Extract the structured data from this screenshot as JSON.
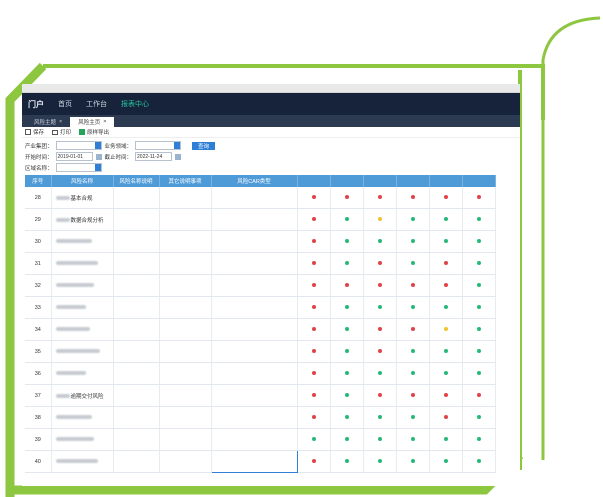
{
  "header": {
    "logo": "门户",
    "nav": [
      "首页",
      "工作台",
      "报表中心"
    ],
    "active_nav": 2
  },
  "tabs": [
    {
      "label": "风险主题"
    },
    {
      "label": "风险主页"
    }
  ],
  "toolbar": {
    "save": "保存",
    "print": "打印",
    "export": "原样导出"
  },
  "filters": {
    "industry_label": "产业集团：",
    "domain_label": "业务领域：",
    "start_label": "开始时间：",
    "start_value": "2019-01-01",
    "end_label": "截止时间：",
    "end_value": "2022-11-24",
    "region_label": "区域名称：",
    "query_btn": "查询"
  },
  "table": {
    "headers": [
      "序号",
      "风险名称",
      "风险名称说明",
      "其它说明事项",
      "风险CAR类型",
      "",
      "",
      "",
      "",
      "",
      ""
    ],
    "rows": [
      {
        "no": "28",
        "name": "基本合规"
      },
      {
        "no": "29",
        "name": "数据合规分析"
      },
      {
        "no": "30",
        "name": ""
      },
      {
        "no": "31",
        "name": ""
      },
      {
        "no": "32",
        "name": ""
      },
      {
        "no": "33",
        "name": ""
      },
      {
        "no": "34",
        "name": ""
      },
      {
        "no": "35",
        "name": ""
      },
      {
        "no": "36",
        "name": ""
      },
      {
        "no": "37",
        "name": "逾期交付风险"
      },
      {
        "no": "38",
        "name": ""
      },
      {
        "no": "39",
        "name": ""
      },
      {
        "no": "40",
        "name": ""
      }
    ],
    "status_colors": {
      "red": "#e0444a",
      "green": "#27b97a",
      "yellow": "#f2c230"
    },
    "status": [
      [
        "red",
        "red",
        "red",
        "red",
        "red",
        "red"
      ],
      [
        "red",
        "green",
        "yellow",
        "green",
        "green",
        "green"
      ],
      [
        "red",
        "green",
        "green",
        "green",
        "green",
        "green"
      ],
      [
        "red",
        "green",
        "red",
        "green",
        "red",
        "green"
      ],
      [
        "red",
        "red",
        "red",
        "red",
        "red",
        "green"
      ],
      [
        "red",
        "green",
        "green",
        "green",
        "green",
        "green"
      ],
      [
        "red",
        "green",
        "red",
        "red",
        "yellow",
        "green"
      ],
      [
        "red",
        "green",
        "red",
        "green",
        "green",
        "green"
      ],
      [
        "red",
        "green",
        "green",
        "green",
        "green",
        "green"
      ],
      [
        "red",
        "green",
        "red",
        "red",
        "red",
        "red"
      ],
      [
        "red",
        "green",
        "green",
        "green",
        "red",
        "green"
      ],
      [
        "green",
        "green",
        "green",
        "green",
        "green",
        "green"
      ],
      [
        "red",
        "green",
        "green",
        "green",
        "green",
        "green"
      ]
    ]
  }
}
